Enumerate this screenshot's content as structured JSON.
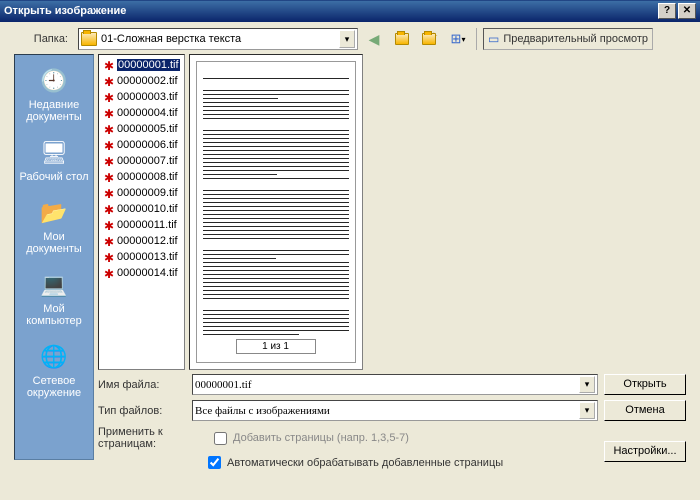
{
  "title": "Открыть изображение",
  "toolbar": {
    "folder_label": "Папка:",
    "folder_name": "01-Сложная верстка текста",
    "preview_toggle": "Предварительный просмотр"
  },
  "places": [
    {
      "label": "Недавние документы",
      "icon": "🕘"
    },
    {
      "label": "Рабочий стол",
      "icon": "🖥"
    },
    {
      "label": "Мои документы",
      "icon": "📂"
    },
    {
      "label": "Мой компьютер",
      "icon": "💻"
    },
    {
      "label": "Сетевое окружение",
      "icon": "🌐"
    }
  ],
  "files": [
    "00000001.tif",
    "00000002.tif",
    "00000003.tif",
    "00000004.tif",
    "00000005.tif",
    "00000006.tif",
    "00000007.tif",
    "00000008.tif",
    "00000009.tif",
    "00000010.tif",
    "00000011.tif",
    "00000012.tif",
    "00000013.tif",
    "00000014.tif"
  ],
  "selected_index": 0,
  "form": {
    "filename_label": "Имя файла:",
    "filename_value": "00000001.tif",
    "filetype_label": "Тип файлов:",
    "filetype_value": "Все файлы с изображениями",
    "apply_label": "Применить к страницам:",
    "add_pages_label": "Добавить страницы (напр. 1,3,5-7)",
    "autoprocess_label": "Автоматически обрабатывать добавленные страницы"
  },
  "buttons": {
    "open": "Открыть",
    "cancel": "Отмена",
    "settings": "Настройки..."
  },
  "preview": {
    "page_indicator": "1 из 1"
  }
}
